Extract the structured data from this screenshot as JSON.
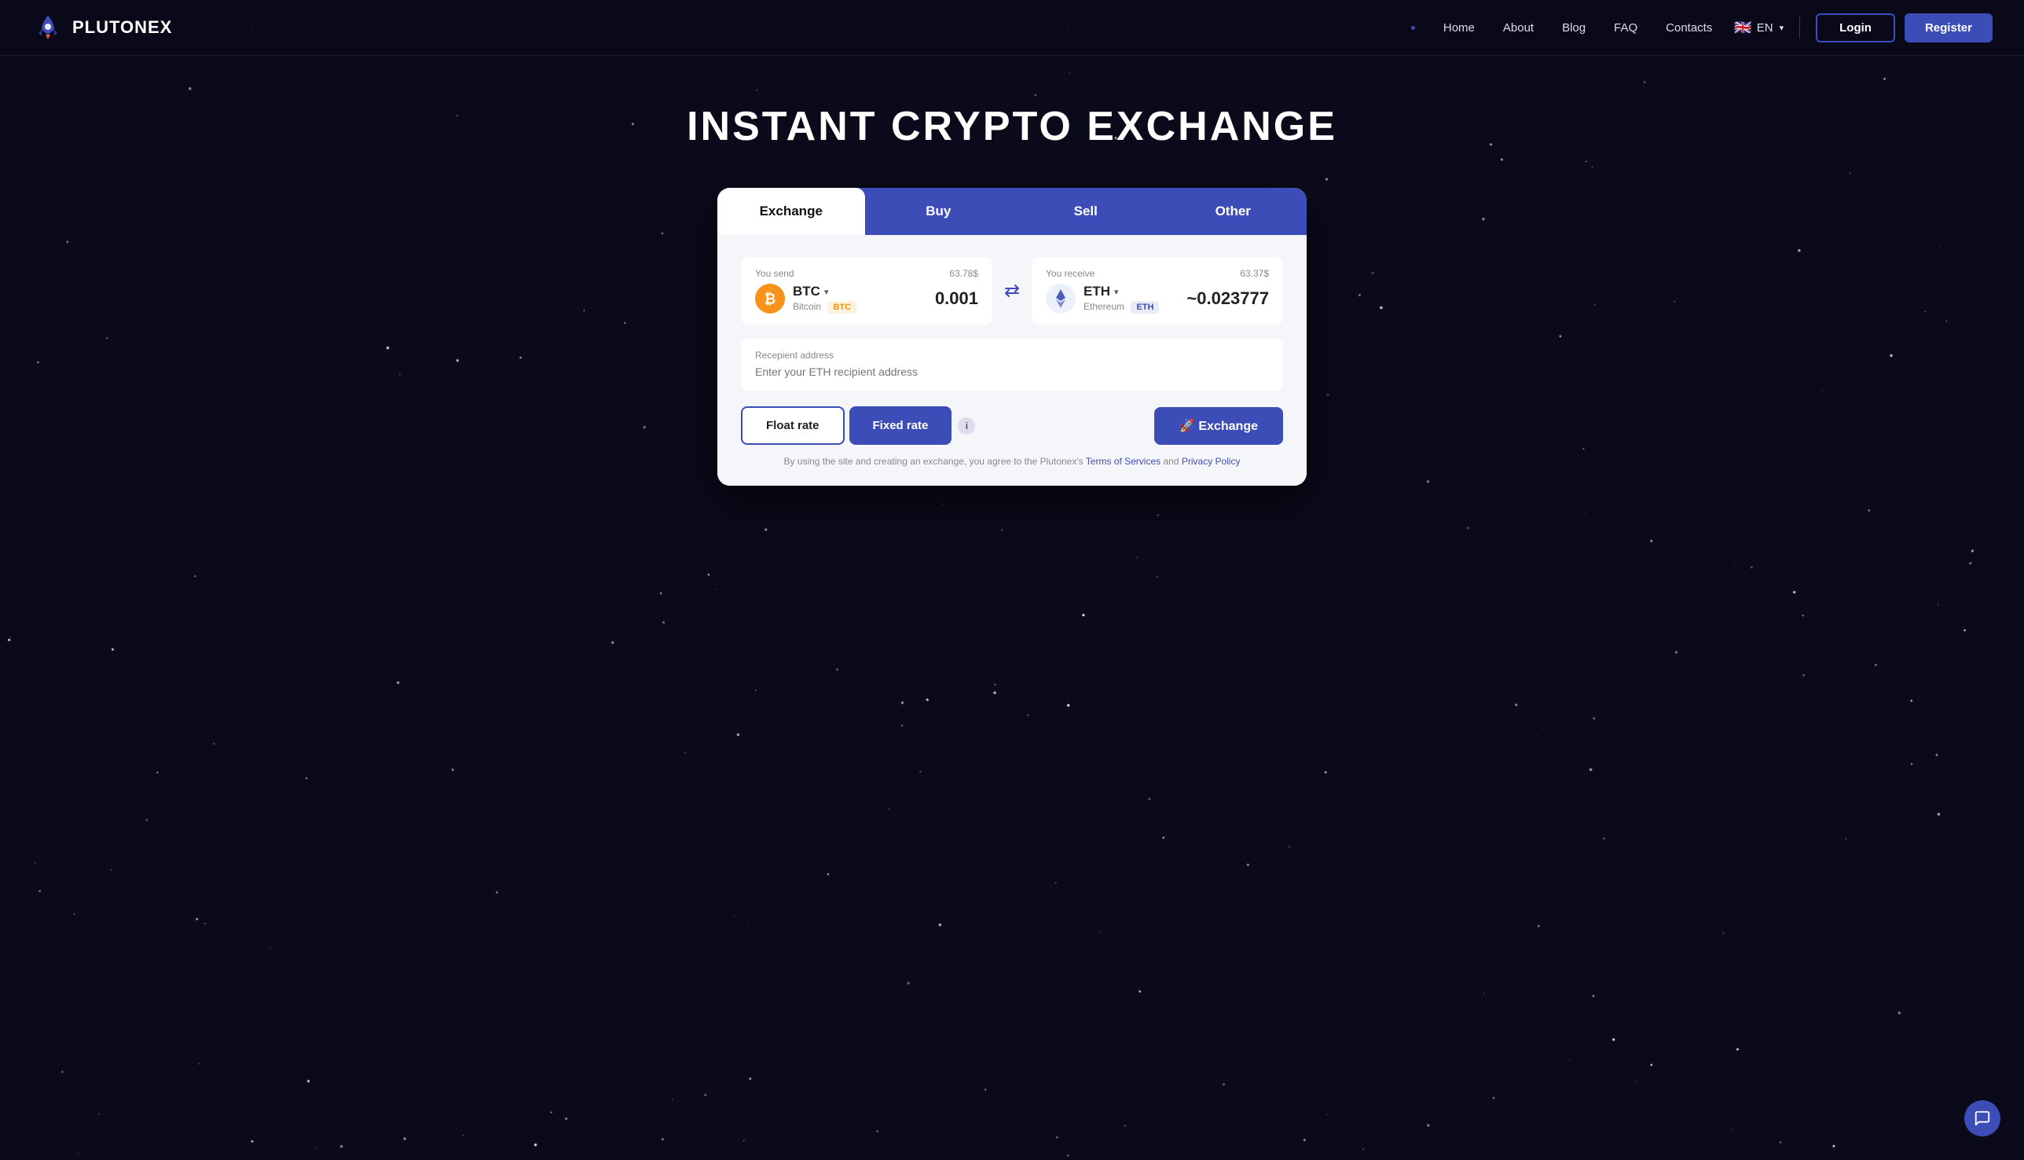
{
  "brand": {
    "name": "PLUTONEX"
  },
  "navbar": {
    "links": [
      {
        "label": "Home",
        "id": "home"
      },
      {
        "label": "About",
        "id": "about"
      },
      {
        "label": "Blog",
        "id": "blog"
      },
      {
        "label": "FAQ",
        "id": "faq"
      },
      {
        "label": "Contacts",
        "id": "contacts"
      }
    ],
    "language": "EN",
    "flag": "🇬🇧",
    "login_label": "Login",
    "register_label": "Register"
  },
  "hero": {
    "title": "INSTANT CRYPTO EXCHANGE"
  },
  "tabs": [
    {
      "label": "Exchange",
      "id": "exchange",
      "active": true
    },
    {
      "label": "Buy",
      "id": "buy",
      "active": false
    },
    {
      "label": "Sell",
      "id": "sell",
      "active": false
    },
    {
      "label": "Other",
      "id": "other",
      "active": false
    }
  ],
  "exchange": {
    "send": {
      "label": "You send",
      "usd": "63.78$",
      "coin": "BTC",
      "coin_full": "Bitcoin",
      "badge": "BTC",
      "amount": "0.001"
    },
    "receive": {
      "label": "You receive",
      "usd": "63.37$",
      "coin": "ETH",
      "coin_full": "Ethereum",
      "badge": "ETH",
      "amount": "~0.023777"
    },
    "recipient": {
      "label": "Recepient address",
      "placeholder": "Enter your ETH recipient address"
    },
    "float_rate_label": "Float rate",
    "fixed_rate_label": "Fixed rate",
    "exchange_label": "🚀 Exchange",
    "terms_text": "By using the site and creating an exchange, you agree to the Plutonex's",
    "terms_of_service": "Terms of Services",
    "terms_and": "and",
    "privacy_policy": "Privacy Policy"
  }
}
